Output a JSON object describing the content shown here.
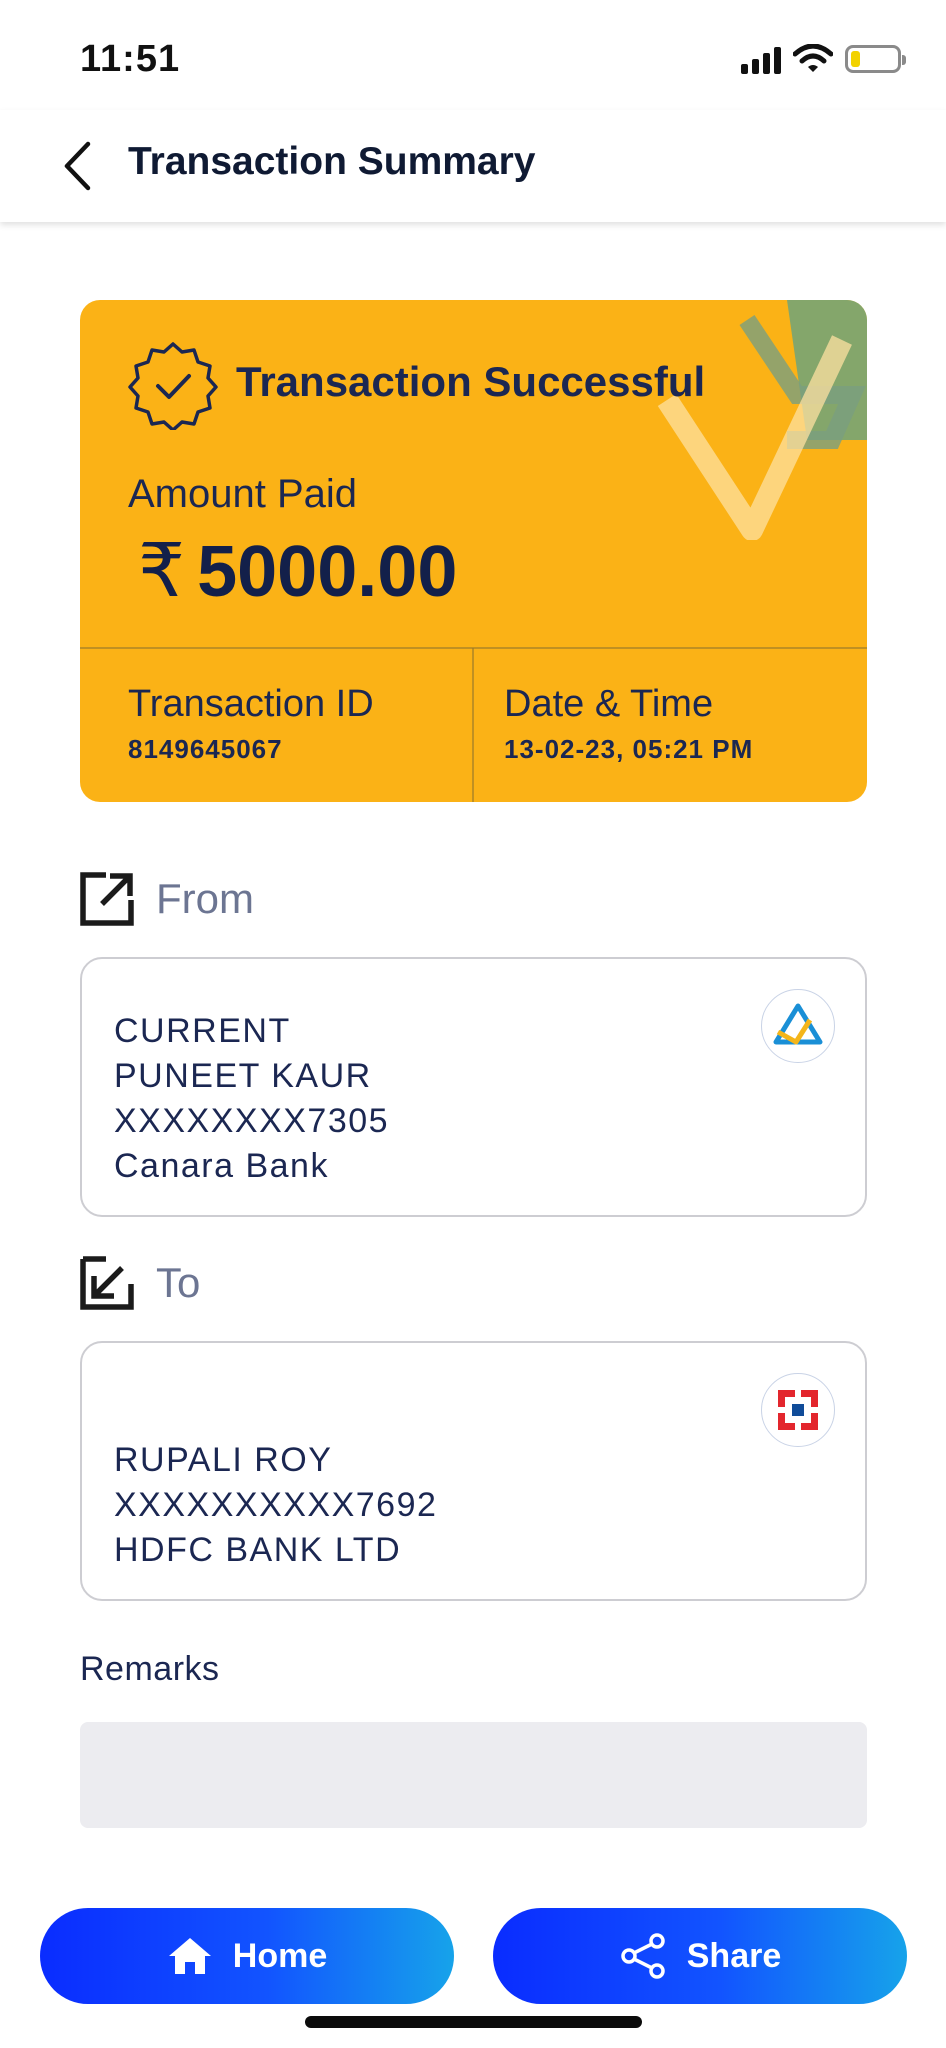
{
  "status_bar": {
    "time": "11:51"
  },
  "header": {
    "title": "Transaction Summary"
  },
  "summary_card": {
    "status_title": "Transaction Successful",
    "amount_label": "Amount Paid",
    "currency_symbol": "₹",
    "amount": "5000.00",
    "transaction_id_label": "Transaction ID",
    "transaction_id": "8149645067",
    "datetime_label": "Date & Time",
    "datetime": "13-02-23, 05:21 PM",
    "card_color": "#fbb216"
  },
  "from": {
    "label": "From",
    "account_type": "CURRENT",
    "name": "PUNEET KAUR",
    "account_number": "XXXXXXXX7305",
    "bank": "Canara Bank",
    "bank_logo": "canara-bank-logo"
  },
  "to": {
    "label": "To",
    "name": "RUPALI ROY",
    "account_number": "XXXXXXXXXX7692",
    "bank": "HDFC BANK LTD",
    "bank_logo": "hdfc-bank-logo"
  },
  "remarks": {
    "label": "Remarks",
    "value": ""
  },
  "buttons": {
    "home_label": "Home",
    "share_label": "Share"
  }
}
